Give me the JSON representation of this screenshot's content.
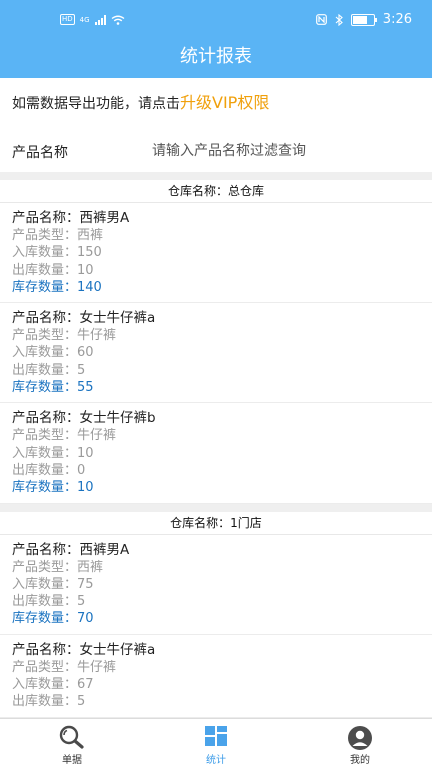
{
  "status_bar": {
    "hd": "HD",
    "network": "4G",
    "time": "3:26"
  },
  "header": {
    "title": "统计报表"
  },
  "notice": {
    "text": "如需数据导出功能，请点击",
    "link": "升级VIP权限"
  },
  "filter": {
    "label": "产品名称",
    "placeholder": "请输入产品名称过滤查询"
  },
  "warehouses": [
    {
      "title": "仓库名称：总仓库",
      "items": [
        {
          "name": "产品名称：西裤男A",
          "type": "产品类型：西裤",
          "in": "入库数量：150",
          "out": "出库数量：10",
          "stock": "库存数量：140"
        },
        {
          "name": "产品名称：女士牛仔裤a",
          "type": "产品类型：牛仔裤",
          "in": "入库数量：60",
          "out": "出库数量：5",
          "stock": "库存数量：55"
        },
        {
          "name": "产品名称：女士牛仔裤b",
          "type": "产品类型：牛仔裤",
          "in": "入库数量：10",
          "out": "出库数量：0",
          "stock": "库存数量：10"
        }
      ]
    },
    {
      "title": "仓库名称：1门店",
      "items": [
        {
          "name": "产品名称：西裤男A",
          "type": "产品类型：西裤",
          "in": "入库数量：75",
          "out": "出库数量：5",
          "stock": "库存数量：70"
        },
        {
          "name": "产品名称：女士牛仔裤a",
          "type": "产品类型：牛仔裤",
          "in": "入库数量：67",
          "out": "出库数量：5",
          "stock": ""
        }
      ]
    }
  ],
  "tabs": [
    {
      "label": "单据",
      "icon": "search-icon",
      "active": false
    },
    {
      "label": "统计",
      "icon": "chart-grid-icon",
      "active": true
    },
    {
      "label": "我的",
      "icon": "user-icon",
      "active": false
    }
  ],
  "colors": {
    "primary": "#5ab4f5",
    "vip": "#f0a00c",
    "stock": "#1b73c0",
    "tab_active": "#3a9be8"
  }
}
